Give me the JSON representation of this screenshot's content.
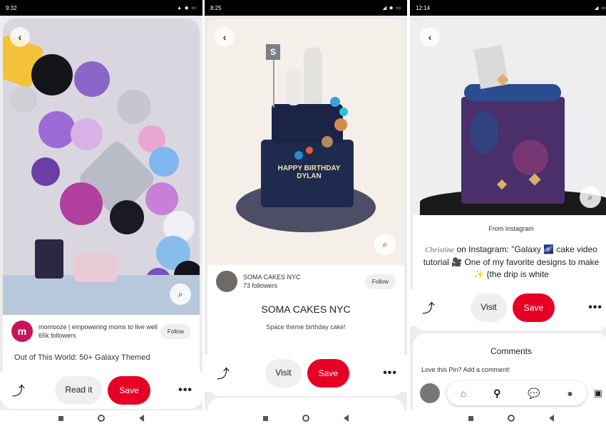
{
  "phones": [
    {
      "status_time": "9:32",
      "author": {
        "name": "momooze | empowering moms to live well",
        "followers": "65k followers",
        "follow_label": "Follow"
      },
      "title_partial": "Out of This World: 50+ Galaxy Themed",
      "actions": {
        "primary": "Read it",
        "save": "Save"
      }
    },
    {
      "status_time": "8:25",
      "cake_text": "HAPPY BIRTHDAY DYLAN",
      "flag_letter": "S",
      "author": {
        "name": "SOMA CAKES NYC",
        "followers": "73 followers",
        "follow_label": "Follow"
      },
      "board_title": "SOMA CAKES NYC",
      "description": "Space theme birthday cake!",
      "actions": {
        "primary": "Visit",
        "save": "Save"
      }
    },
    {
      "status_time": "12:14",
      "source": "From Instagram",
      "caption_name": "Christine",
      "caption": "on Instagram: \"Galaxy 🌌 cake video tutorial 🎥 One of my favorite designs to make ✨ {the drip is white",
      "actions": {
        "primary": "Visit",
        "save": "Save"
      },
      "comments_title": "Comments",
      "comment_prompt": "Love this Pin? Add a comment!"
    }
  ],
  "colors": {
    "save_red": "#e60023",
    "button_grey": "#efefef"
  },
  "icons": [
    "back-arrow-icon",
    "visual-search-icon",
    "share-icon",
    "more-icon",
    "home-icon",
    "search-icon",
    "chat-icon",
    "profile-icon",
    "gallery-icon"
  ]
}
